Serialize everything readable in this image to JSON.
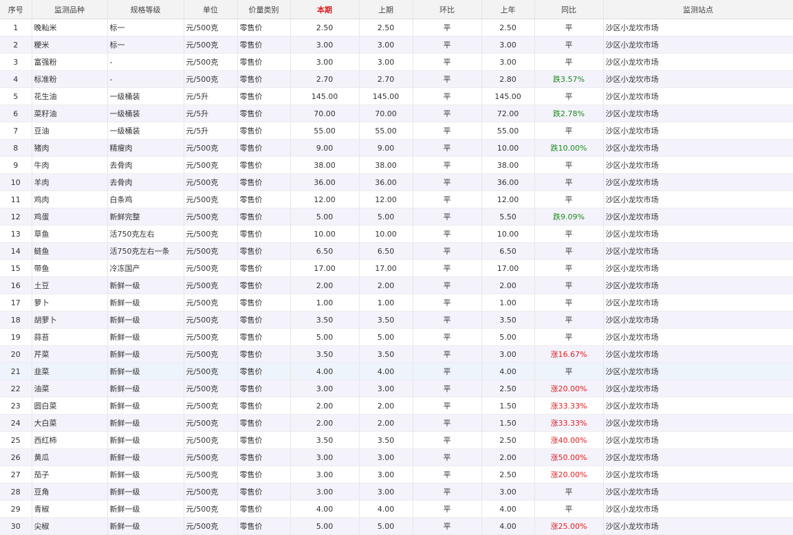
{
  "table": {
    "columns": [
      "序号",
      "监测品种",
      "规格等级",
      "单位",
      "价量类别",
      "本期",
      "上期",
      "环比",
      "上年",
      "同比",
      "监测站点"
    ],
    "rows": [
      {
        "no": "1",
        "name": "晚籼米",
        "grade": "标一",
        "unit": "元/500克",
        "type": "零售价",
        "current": "2.50",
        "previous": "2.50",
        "mom": "平",
        "last_year": "2.50",
        "yoy": "平",
        "yoy_trend": "flat",
        "station": "沙区小龙坎市场"
      },
      {
        "no": "2",
        "name": "粳米",
        "grade": "标一",
        "unit": "元/500克",
        "type": "零售价",
        "current": "3.00",
        "previous": "3.00",
        "mom": "平",
        "last_year": "3.00",
        "yoy": "平",
        "yoy_trend": "flat",
        "station": "沙区小龙坎市场"
      },
      {
        "no": "3",
        "name": "富强粉",
        "grade": "-",
        "unit": "元/500克",
        "type": "零售价",
        "current": "3.00",
        "previous": "3.00",
        "mom": "平",
        "last_year": "3.00",
        "yoy": "平",
        "yoy_trend": "flat",
        "station": "沙区小龙坎市场"
      },
      {
        "no": "4",
        "name": "标准粉",
        "grade": "-",
        "unit": "元/500克",
        "type": "零售价",
        "current": "2.70",
        "previous": "2.70",
        "mom": "平",
        "last_year": "2.80",
        "yoy": "跌3.57%",
        "yoy_trend": "down",
        "station": "沙区小龙坎市场"
      },
      {
        "no": "5",
        "name": "花生油",
        "grade": "一级桶装",
        "unit": "元/5升",
        "type": "零售价",
        "current": "145.00",
        "previous": "145.00",
        "mom": "平",
        "last_year": "145.00",
        "yoy": "平",
        "yoy_trend": "flat",
        "station": "沙区小龙坎市场"
      },
      {
        "no": "6",
        "name": "菜籽油",
        "grade": "一级桶装",
        "unit": "元/5升",
        "type": "零售价",
        "current": "70.00",
        "previous": "70.00",
        "mom": "平",
        "last_year": "72.00",
        "yoy": "跌2.78%",
        "yoy_trend": "down",
        "station": "沙区小龙坎市场"
      },
      {
        "no": "7",
        "name": "豆油",
        "grade": "一级桶装",
        "unit": "元/5升",
        "type": "零售价",
        "current": "55.00",
        "previous": "55.00",
        "mom": "平",
        "last_year": "55.00",
        "yoy": "平",
        "yoy_trend": "flat",
        "station": "沙区小龙坎市场"
      },
      {
        "no": "8",
        "name": "猪肉",
        "grade": "精瘦肉",
        "unit": "元/500克",
        "type": "零售价",
        "current": "9.00",
        "previous": "9.00",
        "mom": "平",
        "last_year": "10.00",
        "yoy": "跌10.00%",
        "yoy_trend": "down",
        "station": "沙区小龙坎市场"
      },
      {
        "no": "9",
        "name": "牛肉",
        "grade": "去骨肉",
        "unit": "元/500克",
        "type": "零售价",
        "current": "38.00",
        "previous": "38.00",
        "mom": "平",
        "last_year": "38.00",
        "yoy": "平",
        "yoy_trend": "flat",
        "station": "沙区小龙坎市场"
      },
      {
        "no": "10",
        "name": "羊肉",
        "grade": "去骨肉",
        "unit": "元/500克",
        "type": "零售价",
        "current": "36.00",
        "previous": "36.00",
        "mom": "平",
        "last_year": "36.00",
        "yoy": "平",
        "yoy_trend": "flat",
        "station": "沙区小龙坎市场"
      },
      {
        "no": "11",
        "name": "鸡肉",
        "grade": "白条鸡",
        "unit": "元/500克",
        "type": "零售价",
        "current": "12.00",
        "previous": "12.00",
        "mom": "平",
        "last_year": "12.00",
        "yoy": "平",
        "yoy_trend": "flat",
        "station": "沙区小龙坎市场"
      },
      {
        "no": "12",
        "name": "鸡蛋",
        "grade": "新鲜完整",
        "unit": "元/500克",
        "type": "零售价",
        "current": "5.00",
        "previous": "5.00",
        "mom": "平",
        "last_year": "5.50",
        "yoy": "跌9.09%",
        "yoy_trend": "down",
        "station": "沙区小龙坎市场"
      },
      {
        "no": "13",
        "name": "草鱼",
        "grade": "活750克左右",
        "unit": "元/500克",
        "type": "零售价",
        "current": "10.00",
        "previous": "10.00",
        "mom": "平",
        "last_year": "10.00",
        "yoy": "平",
        "yoy_trend": "flat",
        "station": "沙区小龙坎市场"
      },
      {
        "no": "14",
        "name": "鲢鱼",
        "grade": "活750克左右一条",
        "unit": "元/500克",
        "type": "零售价",
        "current": "6.50",
        "previous": "6.50",
        "mom": "平",
        "last_year": "6.50",
        "yoy": "平",
        "yoy_trend": "flat",
        "station": "沙区小龙坎市场"
      },
      {
        "no": "15",
        "name": "带鱼",
        "grade": "冷冻国产",
        "unit": "元/500克",
        "type": "零售价",
        "current": "17.00",
        "previous": "17.00",
        "mom": "平",
        "last_year": "17.00",
        "yoy": "平",
        "yoy_trend": "flat",
        "station": "沙区小龙坎市场"
      },
      {
        "no": "16",
        "name": "土豆",
        "grade": "新鲜一级",
        "unit": "元/500克",
        "type": "零售价",
        "current": "2.00",
        "previous": "2.00",
        "mom": "平",
        "last_year": "2.00",
        "yoy": "平",
        "yoy_trend": "flat",
        "station": "沙区小龙坎市场"
      },
      {
        "no": "17",
        "name": "萝卜",
        "grade": "新鲜一级",
        "unit": "元/500克",
        "type": "零售价",
        "current": "1.00",
        "previous": "1.00",
        "mom": "平",
        "last_year": "1.00",
        "yoy": "平",
        "yoy_trend": "flat",
        "station": "沙区小龙坎市场"
      },
      {
        "no": "18",
        "name": "胡萝卜",
        "grade": "新鲜一级",
        "unit": "元/500克",
        "type": "零售价",
        "current": "3.50",
        "previous": "3.50",
        "mom": "平",
        "last_year": "3.50",
        "yoy": "平",
        "yoy_trend": "flat",
        "station": "沙区小龙坎市场"
      },
      {
        "no": "19",
        "name": "蒜苔",
        "grade": "新鲜一级",
        "unit": "元/500克",
        "type": "零售价",
        "current": "5.00",
        "previous": "5.00",
        "mom": "平",
        "last_year": "5.00",
        "yoy": "平",
        "yoy_trend": "flat",
        "station": "沙区小龙坎市场"
      },
      {
        "no": "20",
        "name": "芹菜",
        "grade": "新鲜一级",
        "unit": "元/500克",
        "type": "零售价",
        "current": "3.50",
        "previous": "3.50",
        "mom": "平",
        "last_year": "3.00",
        "yoy": "涨16.67%",
        "yoy_trend": "up",
        "station": "沙区小龙坎市场"
      },
      {
        "no": "21",
        "name": "韭菜",
        "grade": "新鲜一级",
        "unit": "元/500克",
        "type": "零售价",
        "current": "4.00",
        "previous": "4.00",
        "mom": "平",
        "last_year": "4.00",
        "yoy": "平",
        "yoy_trend": "flat",
        "station": "沙区小龙坎市场",
        "highlighted": true
      },
      {
        "no": "22",
        "name": "油菜",
        "grade": "新鲜一级",
        "unit": "元/500克",
        "type": "零售价",
        "current": "3.00",
        "previous": "3.00",
        "mom": "平",
        "last_year": "2.50",
        "yoy": "涨20.00%",
        "yoy_trend": "up",
        "station": "沙区小龙坎市场"
      },
      {
        "no": "23",
        "name": "圆白菜",
        "grade": "新鲜一级",
        "unit": "元/500克",
        "type": "零售价",
        "current": "2.00",
        "previous": "2.00",
        "mom": "平",
        "last_year": "1.50",
        "yoy": "涨33.33%",
        "yoy_trend": "up",
        "station": "沙区小龙坎市场"
      },
      {
        "no": "24",
        "name": "大白菜",
        "grade": "新鲜一级",
        "unit": "元/500克",
        "type": "零售价",
        "current": "2.00",
        "previous": "2.00",
        "mom": "平",
        "last_year": "1.50",
        "yoy": "涨33.33%",
        "yoy_trend": "up",
        "station": "沙区小龙坎市场"
      },
      {
        "no": "25",
        "name": "西红柿",
        "grade": "新鲜一级",
        "unit": "元/500克",
        "type": "零售价",
        "current": "3.50",
        "previous": "3.50",
        "mom": "平",
        "last_year": "2.50",
        "yoy": "涨40.00%",
        "yoy_trend": "up",
        "station": "沙区小龙坎市场"
      },
      {
        "no": "26",
        "name": "黄瓜",
        "grade": "新鲜一级",
        "unit": "元/500克",
        "type": "零售价",
        "current": "3.00",
        "previous": "3.00",
        "mom": "平",
        "last_year": "2.00",
        "yoy": "涨50.00%",
        "yoy_trend": "up",
        "station": "沙区小龙坎市场"
      },
      {
        "no": "27",
        "name": "茄子",
        "grade": "新鲜一级",
        "unit": "元/500克",
        "type": "零售价",
        "current": "3.00",
        "previous": "3.00",
        "mom": "平",
        "last_year": "2.50",
        "yoy": "涨20.00%",
        "yoy_trend": "up",
        "station": "沙区小龙坎市场"
      },
      {
        "no": "28",
        "name": "豆角",
        "grade": "新鲜一级",
        "unit": "元/500克",
        "type": "零售价",
        "current": "3.00",
        "previous": "3.00",
        "mom": "平",
        "last_year": "3.00",
        "yoy": "平",
        "yoy_trend": "flat",
        "station": "沙区小龙坎市场"
      },
      {
        "no": "29",
        "name": "青椒",
        "grade": "新鲜一级",
        "unit": "元/500克",
        "type": "零售价",
        "current": "4.00",
        "previous": "4.00",
        "mom": "平",
        "last_year": "4.00",
        "yoy": "平",
        "yoy_trend": "flat",
        "station": "沙区小龙坎市场"
      },
      {
        "no": "30",
        "name": "尖椒",
        "grade": "新鲜一级",
        "unit": "元/500克",
        "type": "零售价",
        "current": "5.00",
        "previous": "5.00",
        "mom": "平",
        "last_year": "4.00",
        "yoy": "涨25.00%",
        "yoy_trend": "up",
        "station": "沙区小龙坎市场"
      }
    ]
  },
  "colors": {
    "header_current": "#e02020",
    "yoy_up": "#e02020",
    "yoy_down": "#1e8a1e",
    "row_stripe": "#f4f2fb",
    "header_bg": "#f3f3f3"
  }
}
